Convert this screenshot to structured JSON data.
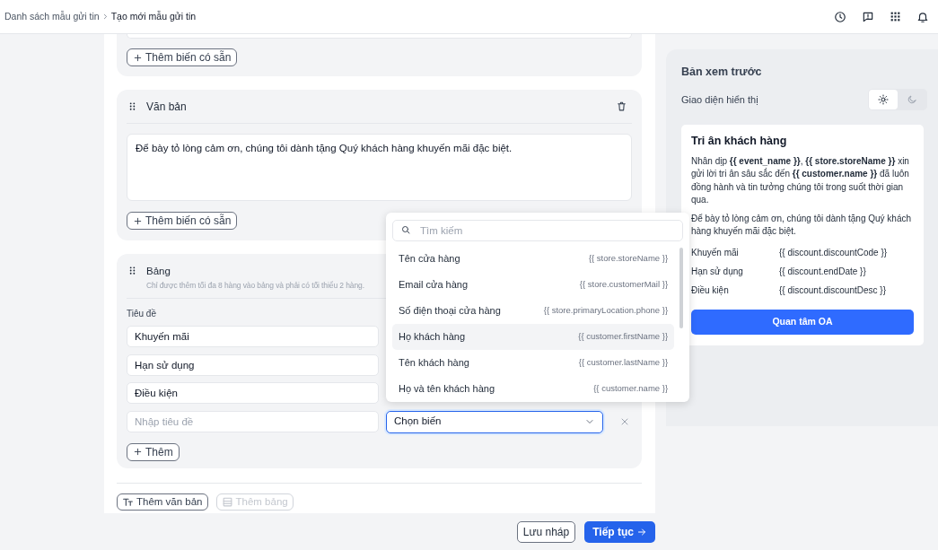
{
  "breadcrumb": [
    {
      "label": "Danh sách mẫu gửi tin",
      "current": false
    },
    {
      "label": "Tạo mới mẫu gửi tin",
      "current": true
    }
  ],
  "top_card": {
    "add_variable_button": "Thêm biến có sẵn"
  },
  "text_block": {
    "title": "Văn bản",
    "content": "Để bày tỏ lòng cảm ơn, chúng tôi dành tặng Quý khách hàng khuyến mãi đặc biệt.",
    "add_variable_button": "Thêm biến có sẵn"
  },
  "table_block": {
    "title": "Bảng",
    "hint": "Chỉ được thêm tối đa 8 hàng vào bảng và phải có tối thiểu 2 hàng.",
    "column_1": "Tiêu đề",
    "rows": [
      {
        "title": "Khuyến mãi"
      },
      {
        "title": "Hạn sử dụng"
      },
      {
        "title": "Điều kiện"
      }
    ],
    "new_row": {
      "title_placeholder": "Nhập tiêu đề",
      "variable_placeholder": "Chọn biến"
    },
    "add_row_button": "Thêm"
  },
  "add_buttons": [
    {
      "kind": "text",
      "label": "Thêm văn bản",
      "disabled": false
    },
    {
      "kind": "table",
      "label": "Thêm bảng",
      "disabled": true
    }
  ],
  "footer": {
    "save_draft": "Lưu nháp",
    "next": "Tiếp tục"
  },
  "dropdown": {
    "search_placeholder": "Tìm kiếm",
    "items": [
      {
        "label": "Tên cửa hàng",
        "variable": "{{ store.storeName }}",
        "selected": false
      },
      {
        "label": "Email cửa hàng",
        "variable": "{{ store.customerMail }}",
        "selected": false
      },
      {
        "label": "Số điện thoại cửa hàng",
        "variable": "{{ store.primaryLocation.phone }}",
        "selected": false
      },
      {
        "label": "Họ khách hàng",
        "variable": "{{ customer.firstName }}",
        "selected": true
      },
      {
        "label": "Tên khách hàng",
        "variable": "{{ customer.lastName }}",
        "selected": false
      },
      {
        "label": "Họ và tên khách hàng",
        "variable": "{{ customer.name }}",
        "selected": false
      }
    ]
  },
  "preview": {
    "title": "Bản xem trước",
    "theme_label": "Giao diện hiển thị",
    "themes": [
      {
        "kind": "light",
        "selected": true
      },
      {
        "kind": "dark",
        "selected": false
      }
    ],
    "card": {
      "title": "Tri ân khách hàng",
      "paragraphs": [
        "Nhân dịp **{{ event_name }}**, **{{ store.storeName }}** xin gửi lời tri ân sâu sắc đến **{{ customer.name }}** đã luôn đồng hành và tin tưởng chúng tôi trong suốt thời gian qua.",
        "Để bày tỏ lòng cảm ơn, chúng tôi dành tặng Quý khách hàng khuyến mãi đặc biệt."
      ],
      "rows": [
        {
          "label": "Khuyến mãi",
          "value": "{{ discount.discountCode }}"
        },
        {
          "label": "Hạn sử dụng",
          "value": "{{ discount.endDate }}"
        },
        {
          "label": "Điều kiện",
          "value": "{{ discount.discountDesc }}"
        }
      ],
      "button": "Quan tâm OA"
    }
  }
}
